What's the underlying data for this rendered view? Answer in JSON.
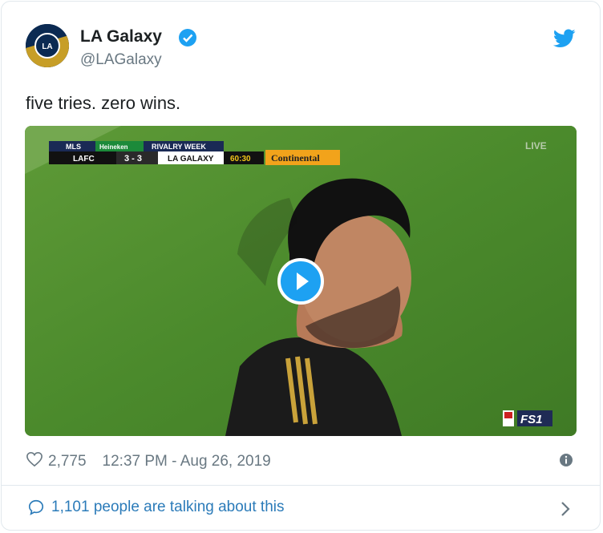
{
  "tweet": {
    "author_name": "LA Galaxy",
    "handle": "@LAGalaxy",
    "text": "five tries. zero wins.",
    "likes": "2,775",
    "timestamp": "12:37 PM - Aug 26, 2019",
    "talking_text": "1,101 people are talking about this"
  },
  "video": {
    "score_league": "MLS",
    "score_sponsor": "Heineken",
    "score_event": "RIVALRY WEEK",
    "home_team": "LAFC",
    "score": "3 - 3",
    "away_team": "LA GALAXY",
    "clock": "60:30",
    "ad_sponsor": "Continental",
    "live_label": "LIVE",
    "broadcaster": "FS1"
  },
  "avatar": {
    "badge_text": "LA"
  },
  "colors": {
    "accent": "#1da1f2",
    "link": "#2b7bb9",
    "muted": "#697882"
  }
}
